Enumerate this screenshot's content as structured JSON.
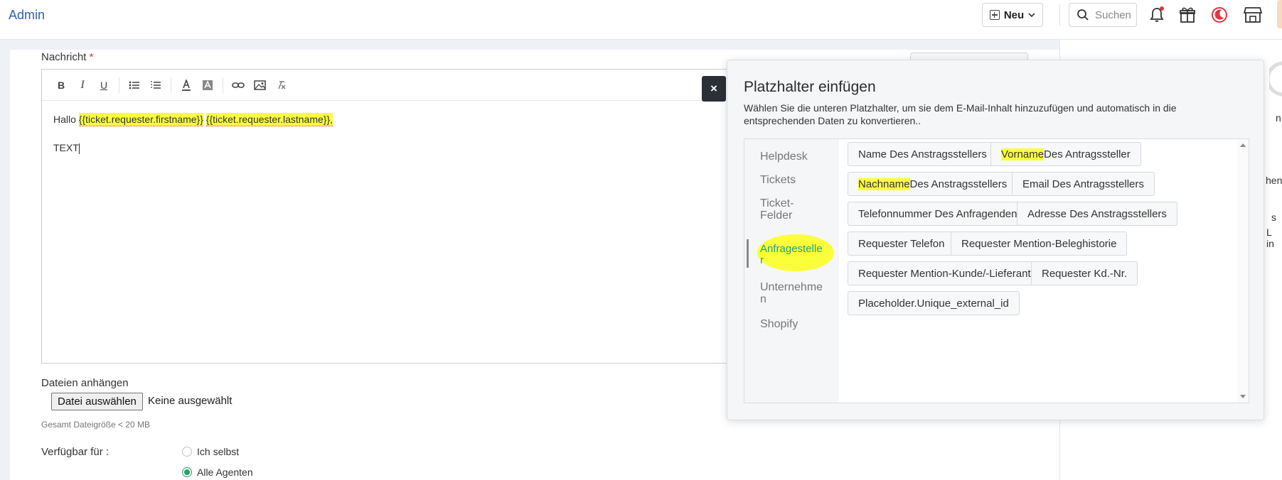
{
  "header": {
    "title": "Admin",
    "new_label": "Neu",
    "search_placeholder": "Suchen"
  },
  "form": {
    "message_label": "Nachricht",
    "required_mark": "*",
    "editor": {
      "line1_prefix": "Hallo",
      "placeholder_firstname": "{{ticket.requester.firstname}}",
      "placeholder_lastname": "{{ticket.requester.lastname}}",
      "line1_suffix": ",",
      "line2": "TEXT"
    },
    "close_symbol": "×",
    "files_label": "Dateien anhängen",
    "file_button": "Datei auswählen",
    "file_none": "Keine ausgewählt",
    "file_size_note": "Gesamt Dateigröße < 20 MB",
    "available_label": "Verfügbar für :",
    "options": [
      {
        "label": "Ich selbst",
        "selected": false
      },
      {
        "label": "Alle Agenten",
        "selected": true
      }
    ]
  },
  "right_fragments": [
    "n",
    "hen",
    "s",
    "L in"
  ],
  "popup": {
    "title": "Platzhalter einfügen",
    "description": "Wählen Sie die unteren Platzhalter, um sie dem E-Mail-Inhalt hinzuzufügen und automatisch in die entsprechenden Daten zu konvertieren..",
    "categories": [
      {
        "label": "Helpdesk"
      },
      {
        "label": "Tickets"
      },
      {
        "label": "Ticket-Felder"
      },
      {
        "label": "Anfragesteller"
      },
      {
        "label": "Unternehmen"
      },
      {
        "label": "Shopify"
      }
    ],
    "chips": [
      {
        "label": "Name Des Anstragsstellers"
      },
      {
        "hl": "Vorname",
        "rest": " Des Antragssteller"
      },
      {
        "hl": "Nachname",
        "rest": " Des Anstragsstellers"
      },
      {
        "label": "Email Des Antragsstellers"
      },
      {
        "label": "Telefonnummer Des Anfragenden"
      },
      {
        "label": "Adresse Des Anstragsstellers"
      },
      {
        "label": "Requester Telefon"
      },
      {
        "label": "Requester Mention-Beleghistorie"
      },
      {
        "label": "Requester Mention-Kunde/-Lieferant"
      },
      {
        "label": "Requester Kd.-Nr."
      },
      {
        "label": "Placeholder.Unique_external_id"
      }
    ]
  },
  "colors": {
    "accent_blue": "#2f5db3",
    "highlight_yellow": "#fbff3a",
    "active_green": "#1ea37a",
    "notification_red": "#e0353f"
  }
}
